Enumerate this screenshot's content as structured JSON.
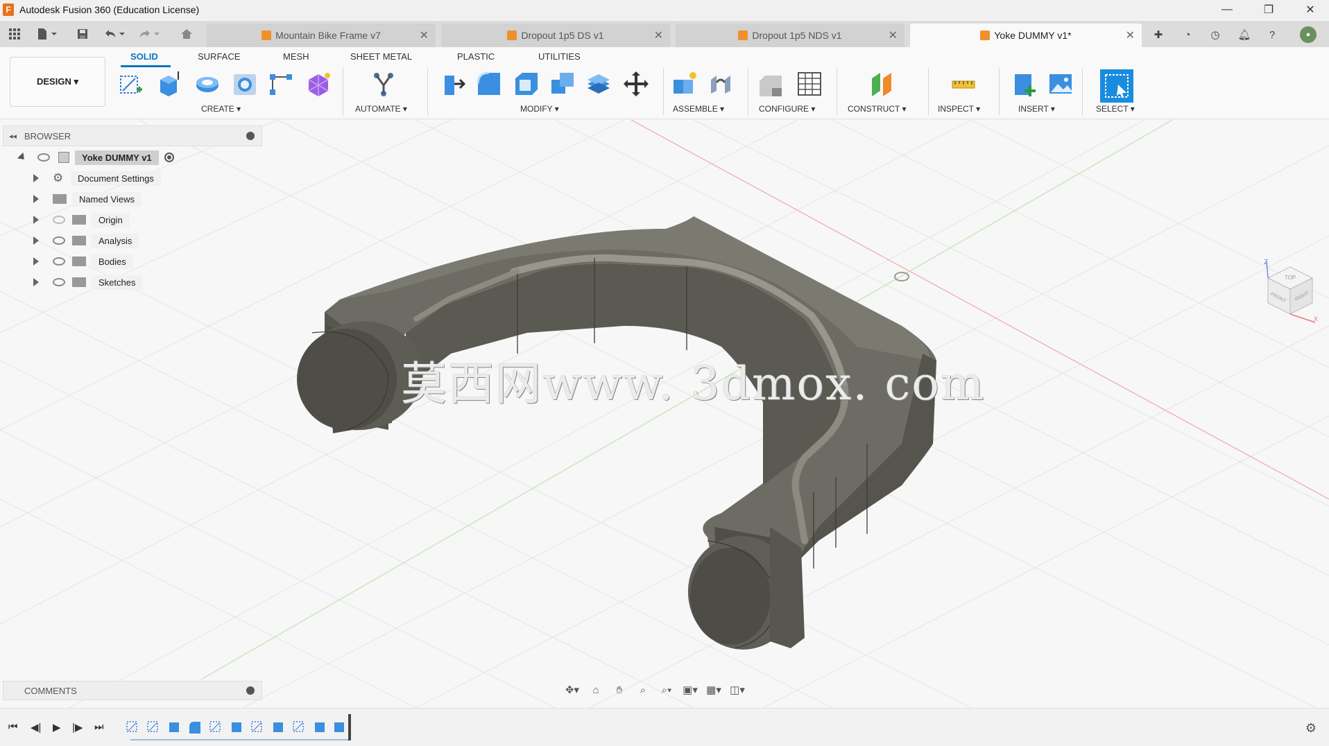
{
  "window": {
    "title": "Autodesk Fusion 360 (Education License)",
    "logo_letter": "F",
    "minimize": "—",
    "restore": "❐",
    "close": "✕"
  },
  "tabs": [
    {
      "label": "Mountain Bike Frame v7",
      "active": false
    },
    {
      "label": "Dropout 1p5 DS v1",
      "active": false
    },
    {
      "label": "Dropout 1p5 NDS v1",
      "active": false
    },
    {
      "label": "Yoke DUMMY v1*",
      "active": true
    }
  ],
  "ribbon": {
    "workspace": "DESIGN ▾",
    "tabs": [
      "SOLID",
      "SURFACE",
      "MESH",
      "SHEET METAL",
      "PLASTIC",
      "UTILITIES"
    ],
    "active_tab": "SOLID",
    "groups": [
      "CREATE ▾",
      "AUTOMATE ▾",
      "MODIFY ▾",
      "ASSEMBLE ▾",
      "CONFIGURE ▾",
      "CONSTRUCT ▾",
      "INSPECT ▾",
      "INSERT ▾",
      "SELECT ▾"
    ]
  },
  "browser": {
    "title": "BROWSER",
    "root": "Yoke DUMMY v1",
    "items": [
      "Document Settings",
      "Named Views",
      "Origin",
      "Analysis",
      "Bodies",
      "Sketches"
    ]
  },
  "comments": {
    "title": "COMMENTS"
  },
  "watermark": "莫西网www. 3dmox. com",
  "viewcube": {
    "faces": [
      "TOP",
      "FRONT",
      "RIGHT"
    ],
    "axes": [
      "Z",
      "X"
    ]
  },
  "colors": {
    "accent": "#0a74c2",
    "model_dark": "#4c4a43",
    "model_mid": "#6b6a62",
    "model_light": "#8c8b82",
    "grid": "#e6e6e6",
    "axis_red": "#f0a0a0",
    "axis_green": "#b8e0a8",
    "tab_icon": "#f0902a"
  }
}
